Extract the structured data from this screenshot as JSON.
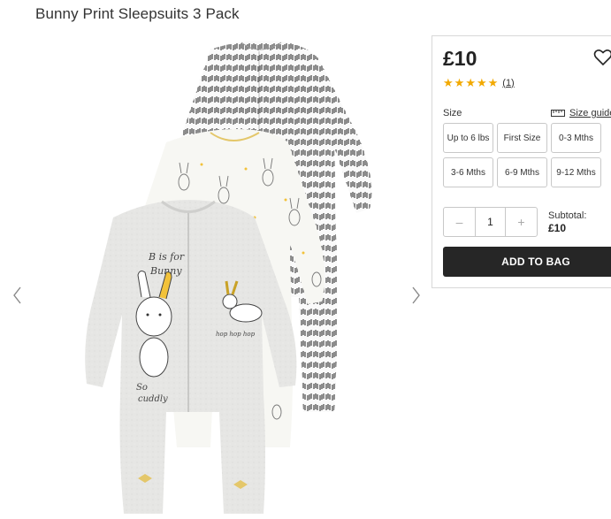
{
  "product": {
    "title": "Bunny Print Sleepsuits 3 Pack",
    "price": "£10",
    "rating_stars": 5,
    "review_count": "(1)",
    "image_text": {
      "b_is_for": "B is for",
      "bunny": "Bunny",
      "so_cuddly_1": "So",
      "so_cuddly_2": "cuddly",
      "hop": "hop hop hop"
    }
  },
  "size_section": {
    "label": "Size",
    "guide_label": "Size guide",
    "options": [
      "Up to 6 lbs",
      "First Size",
      "0-3 Mths",
      "3-6 Mths",
      "6-9 Mths",
      "9-12 Mths"
    ]
  },
  "quantity": {
    "minus": "–",
    "value": "1",
    "plus": "+"
  },
  "subtotal": {
    "label": "Subtotal:",
    "value": "£10"
  },
  "actions": {
    "add_to_bag": "ADD TO BAG"
  },
  "icons": {
    "wishlist": "heart-outline-icon",
    "prev": "chevron-left-icon",
    "next": "chevron-right-icon",
    "size_guide": "ruler-icon",
    "star": "star-icon"
  },
  "colors": {
    "star": "#f2a900",
    "button_bg": "#262626",
    "accent_yellow": "#f2c23a"
  }
}
